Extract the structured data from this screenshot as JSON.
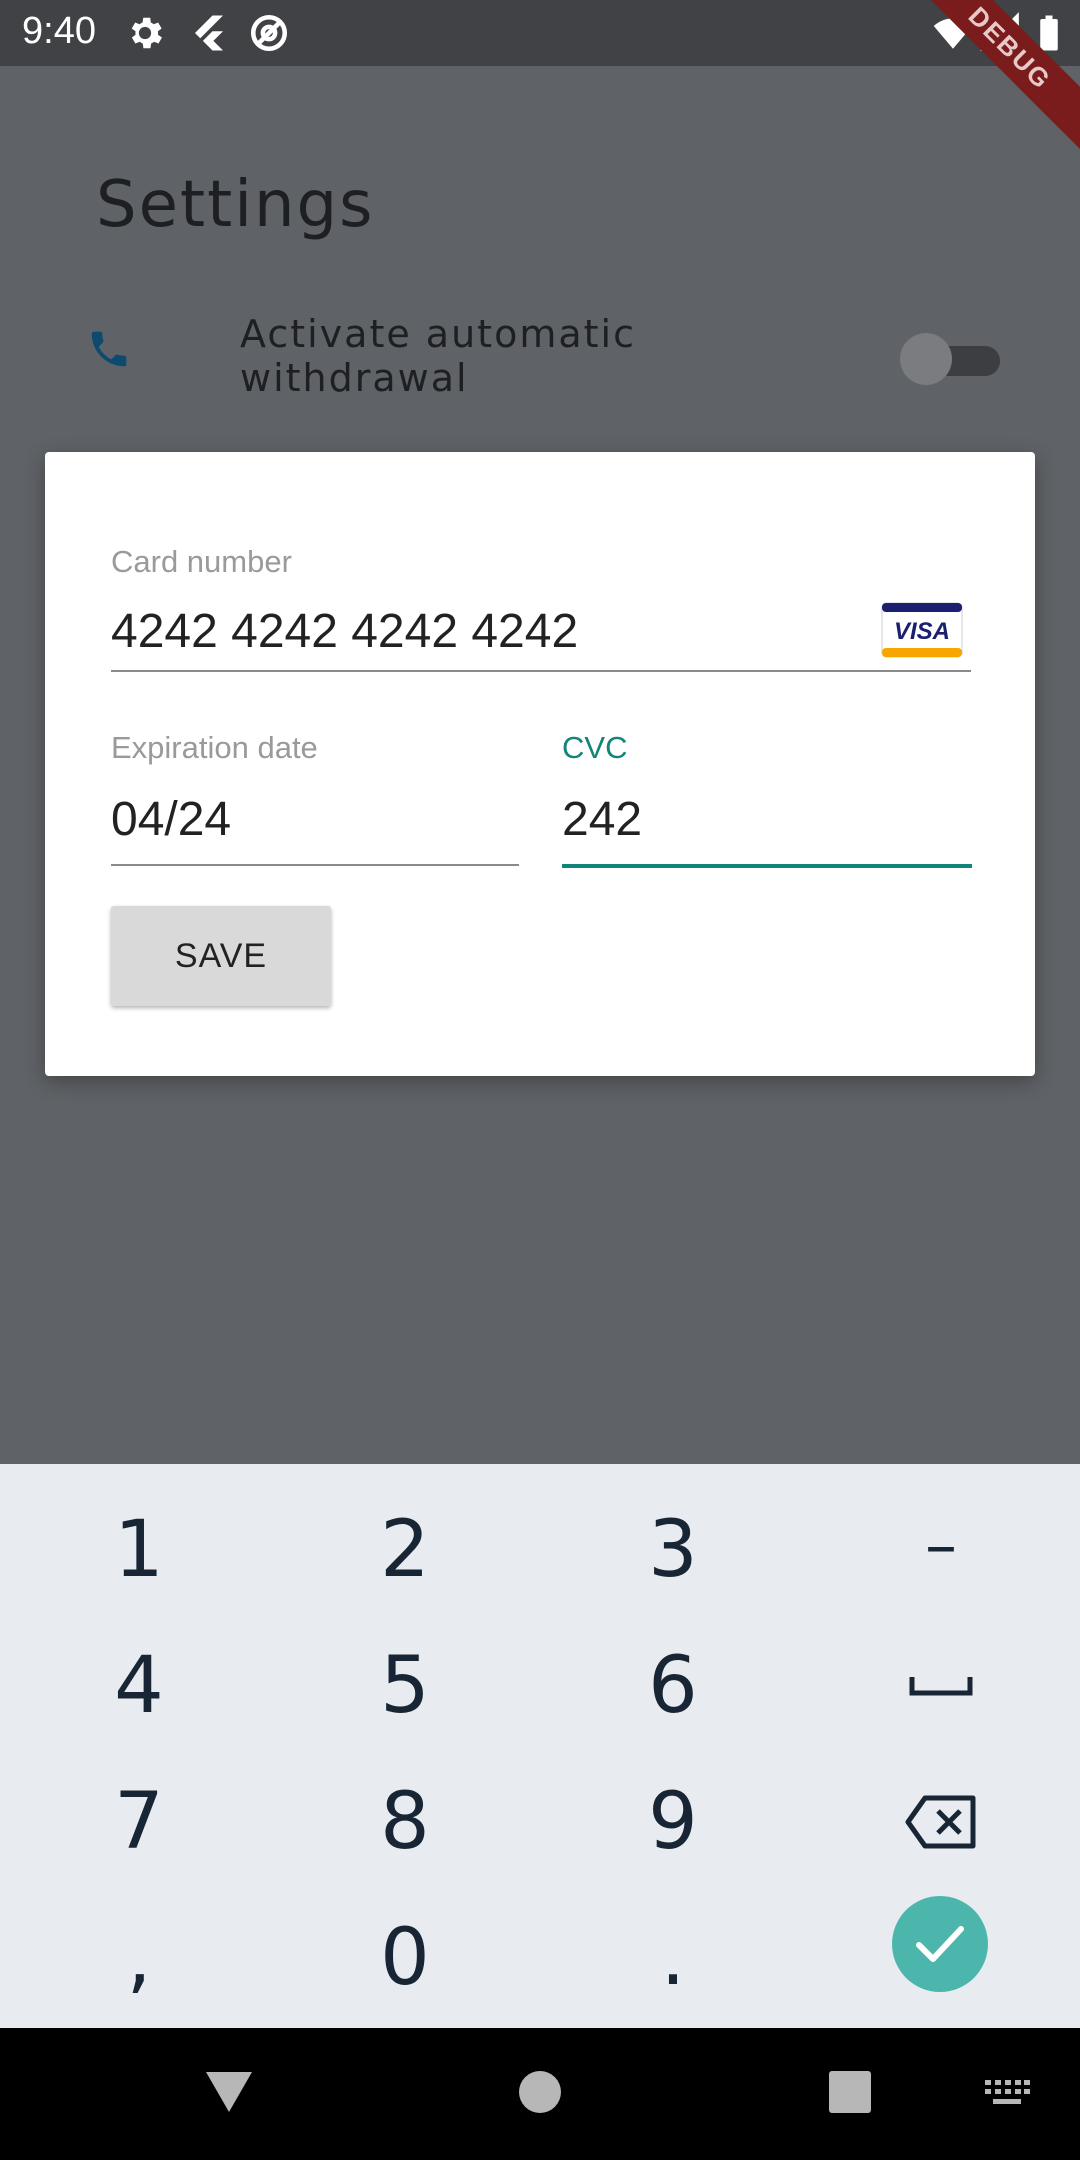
{
  "status_bar": {
    "time": "9:40",
    "icons": [
      "gear-icon",
      "flutter-icon",
      "at-sign-icon",
      "wifi-icon",
      "signal-icon",
      "battery-icon"
    ],
    "debug_banner": "DEBUG"
  },
  "page": {
    "title": "Settings",
    "setting_row": {
      "icon": "phone-icon",
      "label": "Activate automatic withdrawal",
      "toggle_on": false
    }
  },
  "dialog": {
    "card_number": {
      "label": "Card number",
      "value": "4242 4242 4242 4242",
      "brand_icon": "visa-icon",
      "brand_text": "VISA"
    },
    "expiration_date": {
      "label": "Expiration date",
      "value": "04/24"
    },
    "cvc": {
      "label": "CVC",
      "value": "242",
      "focused": true
    },
    "save_label": "SAVE"
  },
  "keyboard": {
    "rows": [
      [
        "1",
        "2",
        "3",
        "–"
      ],
      [
        "4",
        "5",
        "6",
        "space"
      ],
      [
        "7",
        "8",
        "9",
        "backspace"
      ],
      [
        ",",
        "0",
        ".",
        "enter"
      ]
    ]
  },
  "colors": {
    "accent": "#118578",
    "visa_blue": "#1a1f71",
    "visa_orange": "#f7a600",
    "keyboard_enter": "#4db6ac",
    "phone_icon": "#0d4a6e"
  }
}
